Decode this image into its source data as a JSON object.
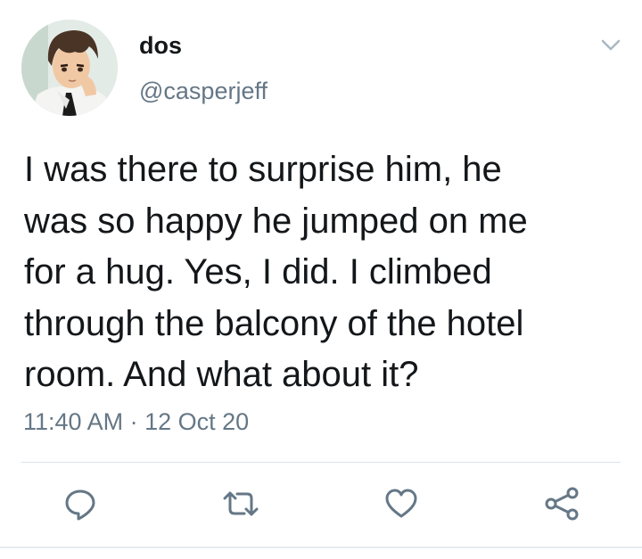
{
  "tweet": {
    "author": {
      "display_name": "dos",
      "handle": "@casperjeff",
      "avatar_icon": "anime-character-avatar"
    },
    "text": "I was there to surprise him, he\nwas so happy he jumped on me\nfor a hug. Yes, I did. I climbed\nthrough the balcony of the hotel\nroom. And what about it?",
    "time": "11:40 AM",
    "separator": "·",
    "date": "12 Oct 20"
  },
  "actions": {
    "reply_icon": "reply-icon",
    "retweet_icon": "retweet-icon",
    "like_icon": "heart-icon",
    "share_icon": "share-icon"
  },
  "colors": {
    "text": "#14171a",
    "secondary": "#657786",
    "icon": "#657786",
    "divider": "#e6ecf0"
  }
}
